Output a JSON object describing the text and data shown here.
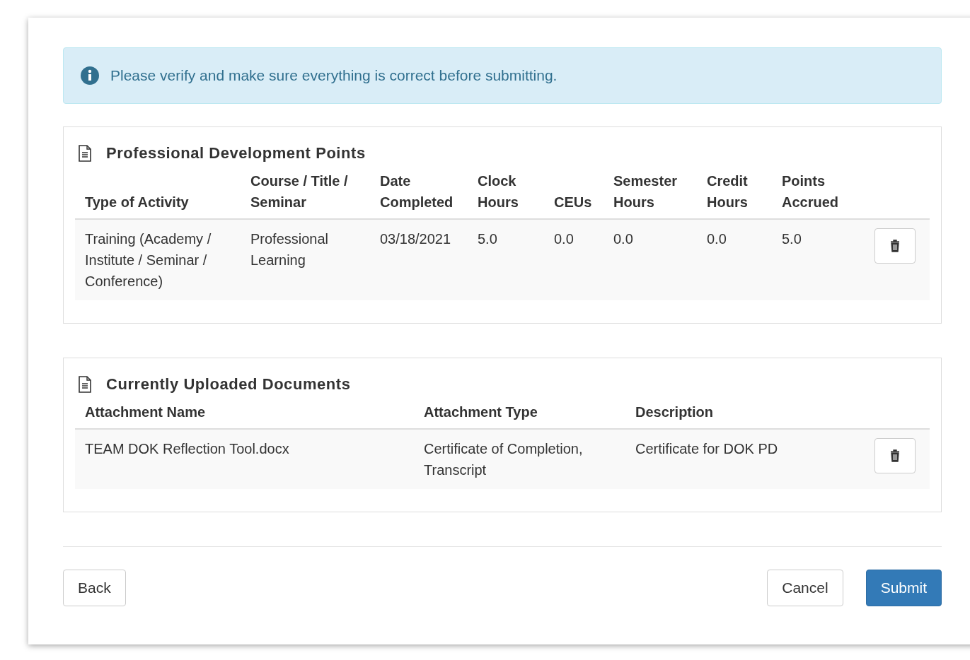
{
  "alert": {
    "text": "Please verify and make sure everything is correct before submitting."
  },
  "points": {
    "title": "Professional Development Points",
    "columns": [
      "Type of Activity",
      "Course / Title / Seminar",
      "Date Completed",
      "Clock Hours",
      "CEUs",
      "Semester Hours",
      "Credit Hours",
      "Points Accrued"
    ],
    "rows": [
      {
        "cells": [
          "Training (Academy / Institute / Seminar / Conference)",
          "Professional Learning",
          "03/18/2021",
          "5.0",
          "0.0",
          "0.0",
          "0.0",
          "5.0"
        ]
      }
    ]
  },
  "documents": {
    "title": "Currently Uploaded Documents",
    "columns": [
      "Attachment Name",
      "Attachment Type",
      "Description"
    ],
    "rows": [
      {
        "cells": [
          "TEAM DOK Reflection Tool.docx",
          "Certificate of Completion, Transcript",
          "Certificate for DOK PD"
        ]
      }
    ]
  },
  "buttons": {
    "back": "Back",
    "cancel": "Cancel",
    "submit": "Submit"
  }
}
